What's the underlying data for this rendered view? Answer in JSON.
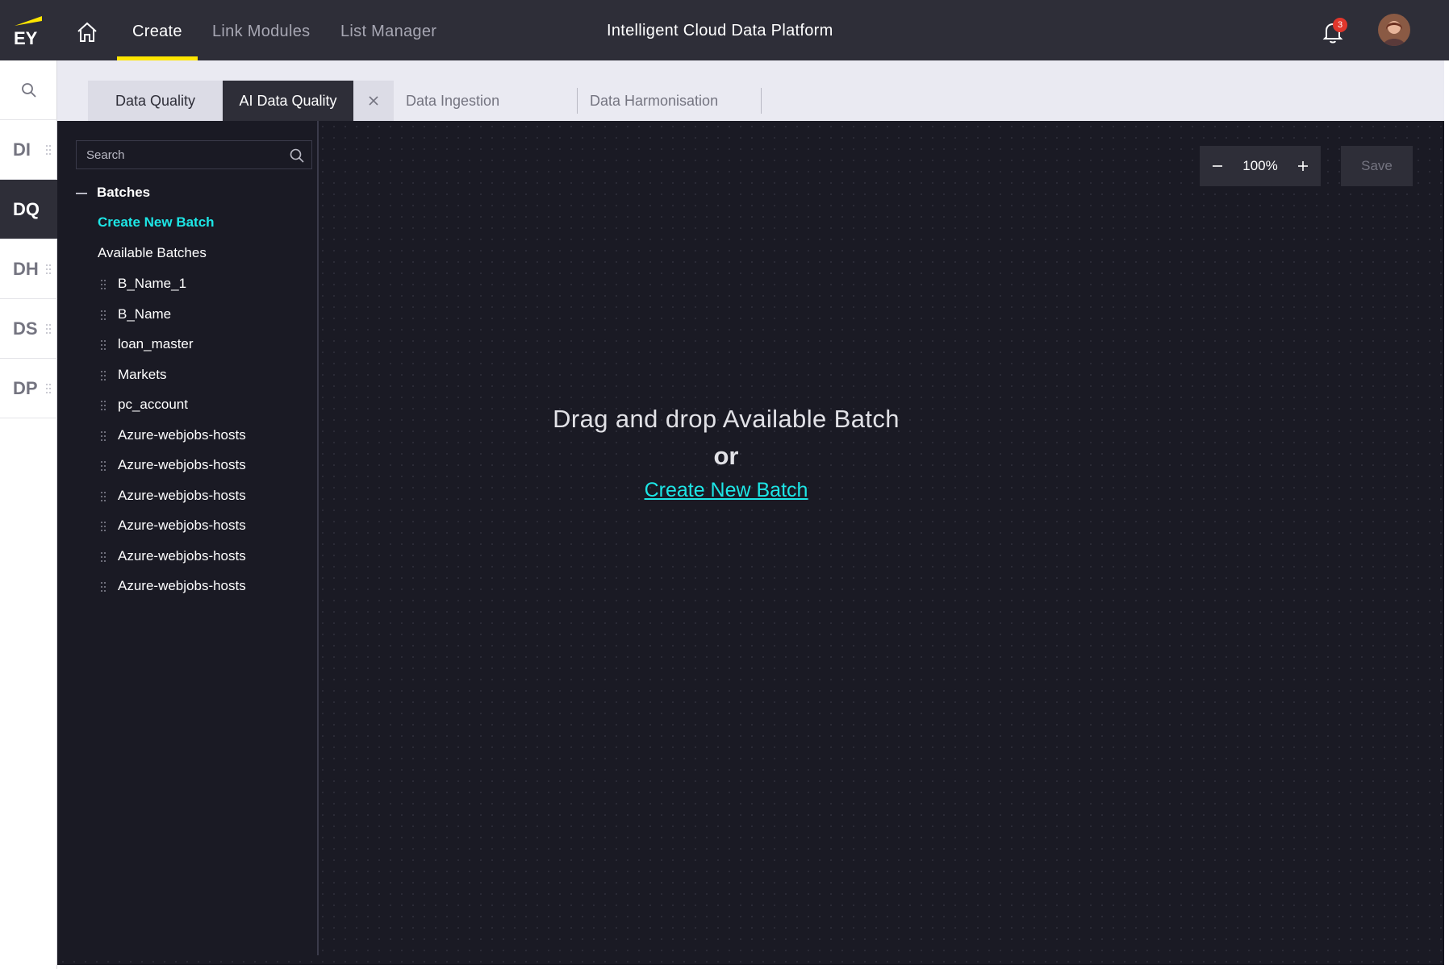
{
  "topbar": {
    "logo_text": "EY",
    "nav": [
      "Create",
      "Link Modules",
      "List Manager"
    ],
    "active_nav": "Create",
    "app_title": "Intelligent Cloud Data Platform",
    "notification_count": "3"
  },
  "rail": {
    "items": [
      "DI",
      "DQ",
      "DH",
      "DS",
      "DP"
    ],
    "active": "DQ"
  },
  "tabs": {
    "data_quality": "Data Quality",
    "ai_data_quality": "AI Data Quality",
    "data_ingestion": "Data Ingestion",
    "data_harmonisation": "Data Harmonisation"
  },
  "panel": {
    "search_placeholder": "Search",
    "batches_label": "Batches",
    "create_new_batch": "Create New Batch",
    "available_batches": "Available Batches",
    "batches": [
      "B_Name_1",
      "B_Name",
      "loan_master",
      "Markets",
      "pc_account",
      "Azure-webjobs-hosts",
      "Azure-webjobs-hosts",
      "Azure-webjobs-hosts",
      "Azure-webjobs-hosts",
      "Azure-webjobs-hosts",
      "Azure-webjobs-hosts"
    ]
  },
  "canvas": {
    "zoom": "100%",
    "save_label": "Save",
    "empty_line1": "Drag and drop Available Batch",
    "empty_or": "or",
    "empty_link": "Create New Batch"
  },
  "colors": {
    "accent_yellow": "#ffe600",
    "link_cyan": "#1de6e6",
    "topbar_bg": "#2e2e38",
    "canvas_bg": "#1a1a24",
    "badge_red": "#e0362c"
  }
}
